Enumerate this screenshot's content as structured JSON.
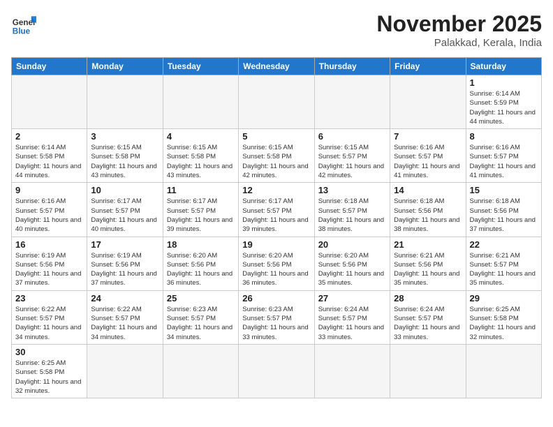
{
  "header": {
    "logo_general": "General",
    "logo_blue": "Blue",
    "month_title": "November 2025",
    "subtitle": "Palakkad, Kerala, India"
  },
  "weekdays": [
    "Sunday",
    "Monday",
    "Tuesday",
    "Wednesday",
    "Thursday",
    "Friday",
    "Saturday"
  ],
  "weeks": [
    [
      {
        "day": "",
        "info": ""
      },
      {
        "day": "",
        "info": ""
      },
      {
        "day": "",
        "info": ""
      },
      {
        "day": "",
        "info": ""
      },
      {
        "day": "",
        "info": ""
      },
      {
        "day": "",
        "info": ""
      },
      {
        "day": "1",
        "info": "Sunrise: 6:14 AM\nSunset: 5:59 PM\nDaylight: 11 hours and 44 minutes."
      }
    ],
    [
      {
        "day": "2",
        "info": "Sunrise: 6:14 AM\nSunset: 5:58 PM\nDaylight: 11 hours and 44 minutes."
      },
      {
        "day": "3",
        "info": "Sunrise: 6:15 AM\nSunset: 5:58 PM\nDaylight: 11 hours and 43 minutes."
      },
      {
        "day": "4",
        "info": "Sunrise: 6:15 AM\nSunset: 5:58 PM\nDaylight: 11 hours and 43 minutes."
      },
      {
        "day": "5",
        "info": "Sunrise: 6:15 AM\nSunset: 5:58 PM\nDaylight: 11 hours and 42 minutes."
      },
      {
        "day": "6",
        "info": "Sunrise: 6:15 AM\nSunset: 5:57 PM\nDaylight: 11 hours and 42 minutes."
      },
      {
        "day": "7",
        "info": "Sunrise: 6:16 AM\nSunset: 5:57 PM\nDaylight: 11 hours and 41 minutes."
      },
      {
        "day": "8",
        "info": "Sunrise: 6:16 AM\nSunset: 5:57 PM\nDaylight: 11 hours and 41 minutes."
      }
    ],
    [
      {
        "day": "9",
        "info": "Sunrise: 6:16 AM\nSunset: 5:57 PM\nDaylight: 11 hours and 40 minutes."
      },
      {
        "day": "10",
        "info": "Sunrise: 6:17 AM\nSunset: 5:57 PM\nDaylight: 11 hours and 40 minutes."
      },
      {
        "day": "11",
        "info": "Sunrise: 6:17 AM\nSunset: 5:57 PM\nDaylight: 11 hours and 39 minutes."
      },
      {
        "day": "12",
        "info": "Sunrise: 6:17 AM\nSunset: 5:57 PM\nDaylight: 11 hours and 39 minutes."
      },
      {
        "day": "13",
        "info": "Sunrise: 6:18 AM\nSunset: 5:57 PM\nDaylight: 11 hours and 38 minutes."
      },
      {
        "day": "14",
        "info": "Sunrise: 6:18 AM\nSunset: 5:56 PM\nDaylight: 11 hours and 38 minutes."
      },
      {
        "day": "15",
        "info": "Sunrise: 6:18 AM\nSunset: 5:56 PM\nDaylight: 11 hours and 37 minutes."
      }
    ],
    [
      {
        "day": "16",
        "info": "Sunrise: 6:19 AM\nSunset: 5:56 PM\nDaylight: 11 hours and 37 minutes."
      },
      {
        "day": "17",
        "info": "Sunrise: 6:19 AM\nSunset: 5:56 PM\nDaylight: 11 hours and 37 minutes."
      },
      {
        "day": "18",
        "info": "Sunrise: 6:20 AM\nSunset: 5:56 PM\nDaylight: 11 hours and 36 minutes."
      },
      {
        "day": "19",
        "info": "Sunrise: 6:20 AM\nSunset: 5:56 PM\nDaylight: 11 hours and 36 minutes."
      },
      {
        "day": "20",
        "info": "Sunrise: 6:20 AM\nSunset: 5:56 PM\nDaylight: 11 hours and 35 minutes."
      },
      {
        "day": "21",
        "info": "Sunrise: 6:21 AM\nSunset: 5:56 PM\nDaylight: 11 hours and 35 minutes."
      },
      {
        "day": "22",
        "info": "Sunrise: 6:21 AM\nSunset: 5:57 PM\nDaylight: 11 hours and 35 minutes."
      }
    ],
    [
      {
        "day": "23",
        "info": "Sunrise: 6:22 AM\nSunset: 5:57 PM\nDaylight: 11 hours and 34 minutes."
      },
      {
        "day": "24",
        "info": "Sunrise: 6:22 AM\nSunset: 5:57 PM\nDaylight: 11 hours and 34 minutes."
      },
      {
        "day": "25",
        "info": "Sunrise: 6:23 AM\nSunset: 5:57 PM\nDaylight: 11 hours and 34 minutes."
      },
      {
        "day": "26",
        "info": "Sunrise: 6:23 AM\nSunset: 5:57 PM\nDaylight: 11 hours and 33 minutes."
      },
      {
        "day": "27",
        "info": "Sunrise: 6:24 AM\nSunset: 5:57 PM\nDaylight: 11 hours and 33 minutes."
      },
      {
        "day": "28",
        "info": "Sunrise: 6:24 AM\nSunset: 5:57 PM\nDaylight: 11 hours and 33 minutes."
      },
      {
        "day": "29",
        "info": "Sunrise: 6:25 AM\nSunset: 5:58 PM\nDaylight: 11 hours and 32 minutes."
      }
    ],
    [
      {
        "day": "30",
        "info": "Sunrise: 6:25 AM\nSunset: 5:58 PM\nDaylight: 11 hours and 32 minutes."
      },
      {
        "day": "",
        "info": ""
      },
      {
        "day": "",
        "info": ""
      },
      {
        "day": "",
        "info": ""
      },
      {
        "day": "",
        "info": ""
      },
      {
        "day": "",
        "info": ""
      },
      {
        "day": "",
        "info": ""
      }
    ]
  ]
}
